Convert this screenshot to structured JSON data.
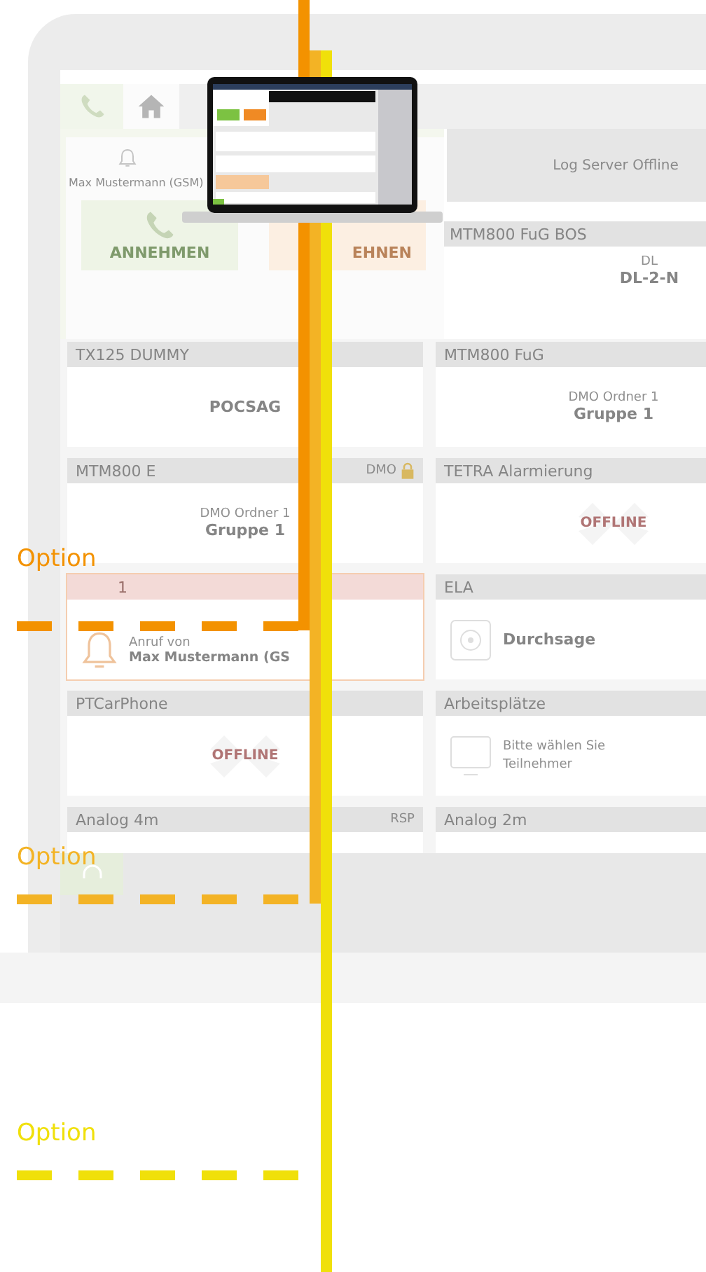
{
  "callouts": [
    {
      "label": "Option",
      "color": "#f39200"
    },
    {
      "label": "Option",
      "color": "#f3b325"
    },
    {
      "label": "Option",
      "color": "#f0e00a"
    }
  ],
  "background_app": {
    "call_panel": {
      "caller": "Max Mustermann (GSM)",
      "accept": "ANNEHMEN",
      "decline": "EHNEN"
    },
    "status_panel": {
      "message": "Log Server Offline",
      "header": "MTM800 FuG BOS",
      "label": "DL",
      "value": "DL-2-N"
    },
    "cards": [
      {
        "title": "TX125 DUMMY",
        "alert": false,
        "kind": "label",
        "value": "POCSAG"
      },
      {
        "title": "MTM800 FuG",
        "alert": false,
        "kind": "group",
        "folder": "DMO Ordner 1",
        "value": "Gruppe 1"
      },
      {
        "title": "MTM800 E",
        "tag": "DMO",
        "locked": true,
        "alert": false,
        "kind": "group",
        "folder": "DMO Ordner 1",
        "value": "Gruppe 1"
      },
      {
        "title": "TETRA Alarmierung",
        "alert": false,
        "kind": "offline",
        "value": "OFFLINE"
      },
      {
        "title": "1",
        "alert": true,
        "kind": "call",
        "caption": "Anruf von",
        "value": "Max Mustermann (GS"
      },
      {
        "title": "ELA",
        "alert": false,
        "kind": "speaker",
        "value": "Durchsage"
      },
      {
        "title": "PTCarPhone",
        "alert": false,
        "kind": "offline",
        "value": "OFFLINE"
      },
      {
        "title": "Arbeitsplätze",
        "alert": false,
        "kind": "prompt",
        "value": "Bitte wählen Sie Teilnehmer"
      },
      {
        "title": "Analog 4m",
        "tag": "RSP",
        "alert": false,
        "kind": "empty"
      },
      {
        "title": "Analog 2m",
        "alert": false,
        "kind": "empty"
      }
    ]
  }
}
